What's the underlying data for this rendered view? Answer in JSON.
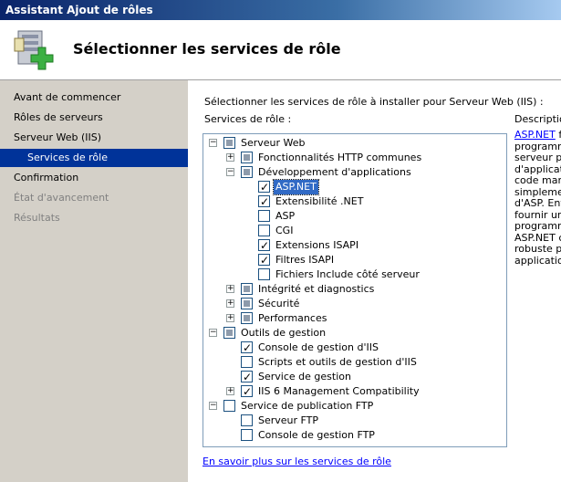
{
  "window": {
    "title": "Assistant Ajout de rôles"
  },
  "header": {
    "title": "Sélectionner les services de rôle",
    "icon": "server-add-icon"
  },
  "nav": {
    "items": [
      {
        "label": "Avant de commencer",
        "state": "normal"
      },
      {
        "label": "Rôles de serveurs",
        "state": "normal"
      },
      {
        "label": "Serveur Web (IIS)",
        "state": "normal"
      },
      {
        "label": "Services de rôle",
        "state": "selected"
      },
      {
        "label": "Confirmation",
        "state": "normal"
      },
      {
        "label": "État d'avancement",
        "state": "disabled"
      },
      {
        "label": "Résultats",
        "state": "disabled"
      }
    ]
  },
  "main": {
    "instruction": "Sélectionner les services de rôle à installer pour Serveur Web (IIS) :",
    "tree_label": "Services de rôle :",
    "description_label": "Description :",
    "description_lines": [
      "ASP.NET f",
      "programm",
      "serveur p",
      "d'applicati",
      "code man",
      "simpleme",
      "d'ASP. Ent",
      "fournir un",
      "programm",
      "ASP.NET c",
      "robuste p",
      "application"
    ],
    "link": "En savoir plus sur les services de rôle"
  },
  "tree": [
    {
      "label": "Serveur Web",
      "level": 0,
      "expander": "minus",
      "check": "tri"
    },
    {
      "label": "Fonctionnalités HTTP communes",
      "level": 1,
      "expander": "plus",
      "check": "tri"
    },
    {
      "label": "Développement d'applications",
      "level": 1,
      "expander": "minus",
      "check": "tri"
    },
    {
      "label": "ASP.NET",
      "level": 2,
      "expander": "",
      "check": "checked",
      "selected": true
    },
    {
      "label": "Extensibilité .NET",
      "level": 2,
      "expander": "",
      "check": "checked"
    },
    {
      "label": "ASP",
      "level": 2,
      "expander": "",
      "check": "unchecked"
    },
    {
      "label": "CGI",
      "level": 2,
      "expander": "",
      "check": "unchecked"
    },
    {
      "label": "Extensions ISAPI",
      "level": 2,
      "expander": "",
      "check": "checked"
    },
    {
      "label": "Filtres ISAPI",
      "level": 2,
      "expander": "",
      "check": "checked"
    },
    {
      "label": "Fichiers Include côté serveur",
      "level": 2,
      "expander": "",
      "check": "unchecked"
    },
    {
      "label": "Intégrité et diagnostics",
      "level": 1,
      "expander": "plus",
      "check": "tri"
    },
    {
      "label": "Sécurité",
      "level": 1,
      "expander": "plus",
      "check": "tri"
    },
    {
      "label": "Performances",
      "level": 1,
      "expander": "plus",
      "check": "tri"
    },
    {
      "label": "Outils de gestion",
      "level": 0,
      "expander": "minus",
      "check": "tri"
    },
    {
      "label": "Console de gestion d'IIS",
      "level": 1,
      "expander": "",
      "check": "checked"
    },
    {
      "label": "Scripts et outils de gestion d'IIS",
      "level": 1,
      "expander": "",
      "check": "unchecked"
    },
    {
      "label": "Service de gestion",
      "level": 1,
      "expander": "",
      "check": "checked"
    },
    {
      "label": "IIS 6 Management Compatibility",
      "level": 1,
      "expander": "plus",
      "check": "checked"
    },
    {
      "label": "Service de publication FTP",
      "level": 0,
      "expander": "minus",
      "check": "unchecked"
    },
    {
      "label": "Serveur FTP",
      "level": 1,
      "expander": "",
      "check": "unchecked"
    },
    {
      "label": "Console de gestion FTP",
      "level": 1,
      "expander": "",
      "check": "unchecked"
    }
  ]
}
